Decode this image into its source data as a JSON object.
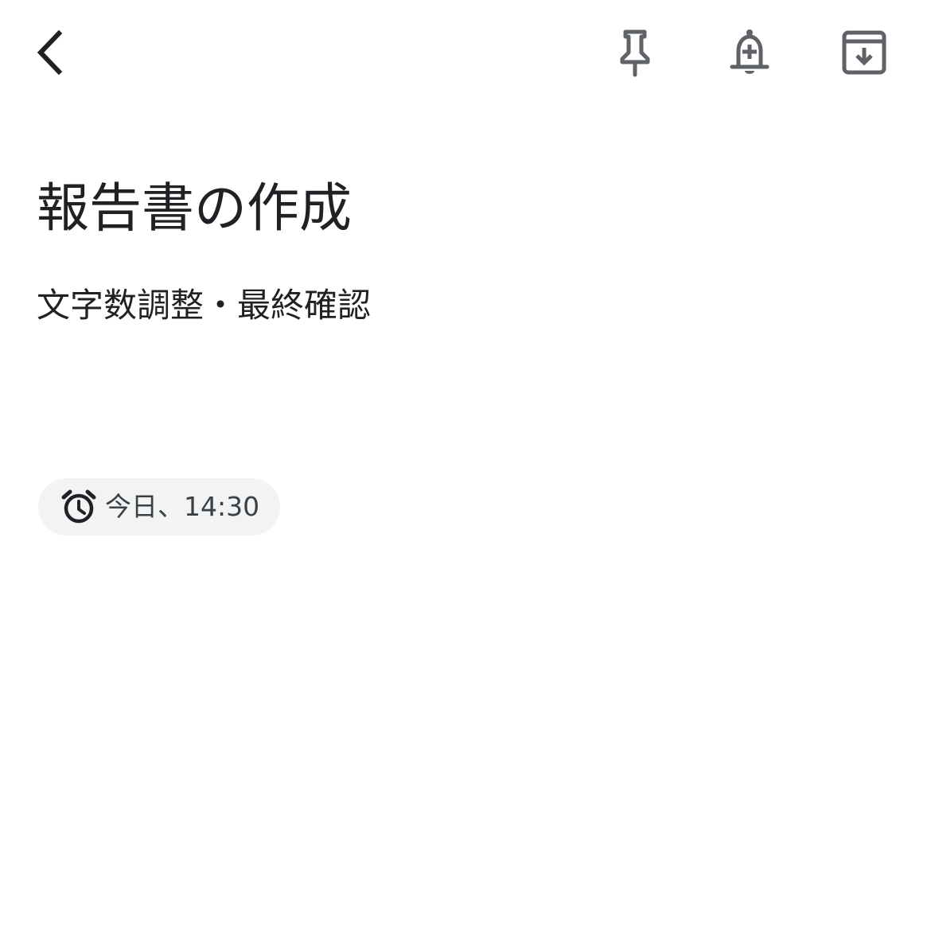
{
  "toolbar": {
    "back_icon": "arrow-back-icon",
    "pin_icon": "pin-icon",
    "reminder_icon": "add-alert-icon",
    "archive_icon": "archive-icon",
    "icon_color": "#5f6368"
  },
  "note": {
    "title": "報告書の作成",
    "body": "文字数調整・最終確認"
  },
  "reminder": {
    "icon": "alarm-icon",
    "label": "今日、14:30",
    "chip_background": "#f1f3f4"
  }
}
